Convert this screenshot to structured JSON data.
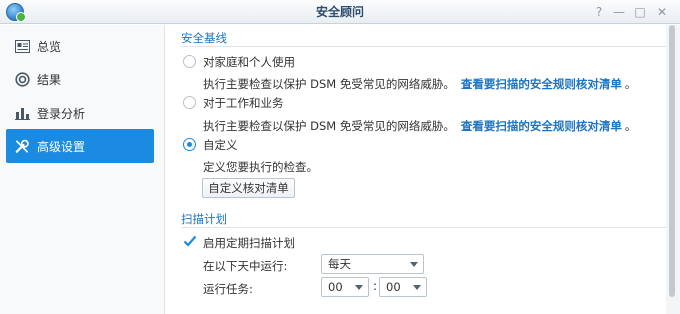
{
  "window": {
    "title": "安全顾问",
    "controls": {
      "help": "?",
      "minimize": "—",
      "maximize": "□",
      "close": "✕"
    }
  },
  "sidebar": {
    "items": [
      {
        "label": "总览",
        "icon": "overview-icon"
      },
      {
        "label": "结果",
        "icon": "results-icon"
      },
      {
        "label": "登录分析",
        "icon": "bar-chart-icon"
      },
      {
        "label": "高级设置",
        "icon": "tools-icon",
        "active": true
      }
    ]
  },
  "baseline": {
    "title": "安全基线",
    "options": [
      {
        "label": "对家庭和个人使用",
        "desc": "执行主要检查以保护 DSM 免受常见的网络威胁。",
        "link": "查看要扫描的安全规则核对清单",
        "suffix": "。",
        "selected": false
      },
      {
        "label": "对于工作和业务",
        "desc": "执行主要检查以保护 DSM 免受常见的网络威胁。",
        "link": "查看要扫描的安全规则核对清单",
        "suffix": "。",
        "selected": false
      },
      {
        "label": "自定义",
        "desc": "定义您要执行的检查。",
        "selected": true
      }
    ],
    "custom_button": "自定义核对清单"
  },
  "schedule": {
    "title": "扫描计划",
    "enable_label": "启用定期扫描计划",
    "enabled": true,
    "day_label": "在以下天中运行:",
    "day_value": "每天",
    "time_label": "运行任务:",
    "hour_value": "00",
    "minute_value": "00",
    "separator": ":"
  },
  "colors": {
    "accent": "#1a8be0",
    "link": "#1b74c4"
  }
}
